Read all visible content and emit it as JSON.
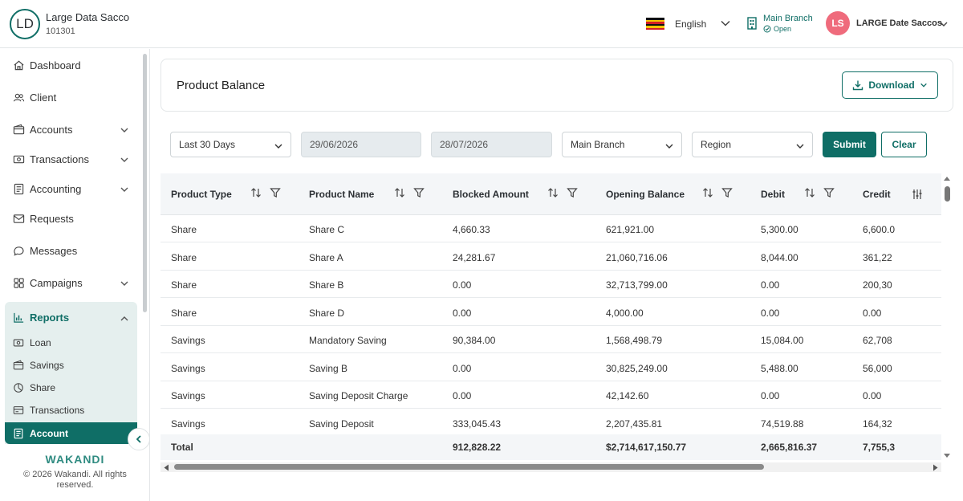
{
  "header": {
    "org_initials": "LD",
    "org_name": "Large Data Sacco",
    "org_code": "101301",
    "language": "English",
    "branch_name": "Main Branch",
    "branch_status": "Open",
    "user_initials": "LS",
    "user_name": "LARGE Date Saccos"
  },
  "sidebar": {
    "items": [
      {
        "label": "Dashboard",
        "icon": "home-icon"
      },
      {
        "label": "Client",
        "icon": "users-icon"
      },
      {
        "label": "Accounts",
        "icon": "wallet-icon",
        "expandable": true
      },
      {
        "label": "Transactions",
        "icon": "money-icon",
        "expandable": true
      },
      {
        "label": "Accounting",
        "icon": "ledger-icon",
        "expandable": true
      },
      {
        "label": "Requests",
        "icon": "mail-icon"
      },
      {
        "label": "Messages",
        "icon": "chat-icon"
      },
      {
        "label": "Campaigns",
        "icon": "grid-icon",
        "expandable": true
      }
    ],
    "reports": {
      "label": "Reports",
      "items": [
        "Loan",
        "Savings",
        "Share",
        "Transactions"
      ],
      "active": "Account"
    },
    "brand": "WAKANDI",
    "copyright": "© 2026 Wakandi. All rights reserved."
  },
  "page": {
    "title": "Product Balance",
    "download_label": "Download"
  },
  "filters": {
    "period": "Last 30 Days",
    "date_from": "29/06/2026",
    "date_to": "28/07/2026",
    "branch": "Main Branch",
    "region": "Region",
    "submit_label": "Submit",
    "clear_label": "Clear"
  },
  "table": {
    "columns": [
      "Product Type",
      "Product Name",
      "Blocked Amount",
      "Opening Balance",
      "Debit",
      "Credit"
    ],
    "rows": [
      [
        "Share",
        "Share C",
        "4,660.33",
        "621,921.00",
        "5,300.00",
        "6,600.0"
      ],
      [
        "Share",
        "Share A",
        "24,281.67",
        "21,060,716.06",
        "8,044.00",
        "361,22"
      ],
      [
        "Share",
        "Share B",
        "0.00",
        "32,713,799.00",
        "0.00",
        "200,30"
      ],
      [
        "Share",
        "Share D",
        "0.00",
        "4,000.00",
        "0.00",
        "0.00"
      ],
      [
        "Savings",
        "Mandatory Saving",
        "90,384.00",
        "1,568,498.79",
        "15,084.00",
        "62,708"
      ],
      [
        "Savings",
        "Saving B",
        "0.00",
        "30,825,249.00",
        "5,488.00",
        "56,000"
      ],
      [
        "Savings",
        "Saving Deposit Charge",
        "0.00",
        "42,142.60",
        "0.00",
        "0.00"
      ],
      [
        "Savings",
        "Saving Deposit",
        "333,045.43",
        "2,207,435.81",
        "74,519.88",
        "164,32"
      ]
    ],
    "total": [
      "Total",
      "",
      "912,828.22",
      "$2,714,617,150.77",
      "2,665,816.37",
      "7,755,3"
    ]
  },
  "colors": {
    "primary": "#0f6e66",
    "sidebar_group_bg": "#e5efee",
    "avatar_bg": "#ef6b7c"
  }
}
